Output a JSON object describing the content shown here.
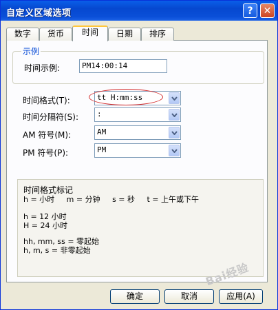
{
  "window": {
    "title": "自定义区域选项",
    "help": "?",
    "close": "✕"
  },
  "tabs": [
    {
      "label": "数字"
    },
    {
      "label": "货币"
    },
    {
      "label": "时间"
    },
    {
      "label": "日期"
    },
    {
      "label": "排序"
    }
  ],
  "example": {
    "legend": "示例",
    "label": "时间示例:",
    "value": "PM14:00:14"
  },
  "fields": {
    "time_format": {
      "label": "时间格式(T):",
      "value": "tt H:mm:ss"
    },
    "separator": {
      "label": "时间分隔符(S):",
      "value": ":"
    },
    "am": {
      "label": "AM 符号(M):",
      "value": "AM"
    },
    "pm": {
      "label": "PM 符号(P):",
      "value": "PM"
    }
  },
  "notation": {
    "title": "时间格式标记",
    "line1": "h = 小时     m = 分钟     s = 秒     t = 上午或下午",
    "line2": "h = 12 小时",
    "line3": "H = 24 小时",
    "line4": "hh, mm, ss = 零起始",
    "line5": "h, m, s = 非零起始"
  },
  "buttons": {
    "ok": "确定",
    "cancel": "取消",
    "apply": "应用(A)"
  },
  "watermark": "Bai经验",
  "colors": {
    "titlebar": "#0a5ee8",
    "highlight_ring": "#d42a2a",
    "active_tab_accent": "#ffc73c"
  }
}
